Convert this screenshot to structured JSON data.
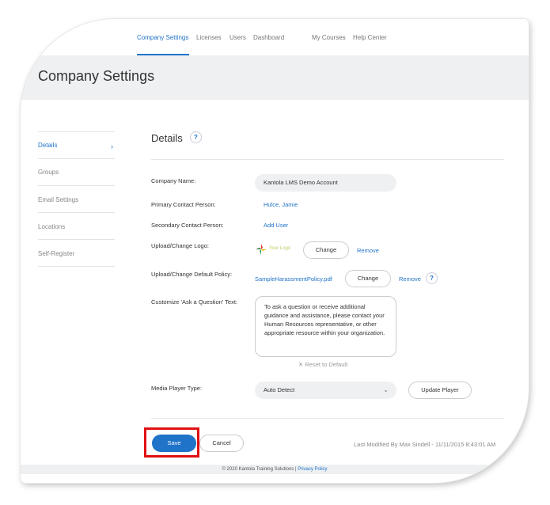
{
  "nav": {
    "items": [
      {
        "label": "Company Settings",
        "active": true
      },
      {
        "label": "Licenses",
        "active": false
      },
      {
        "label": "Users",
        "active": false
      },
      {
        "label": "Dashboard",
        "active": false
      },
      {
        "label": "My Courses",
        "active": false
      },
      {
        "label": "Help Center",
        "active": false
      }
    ]
  },
  "page_title": "Company Settings",
  "sidebar": {
    "items": [
      {
        "label": "Details",
        "active": true
      },
      {
        "label": "Groups",
        "active": false
      },
      {
        "label": "Email Settings",
        "active": false
      },
      {
        "label": "Locations",
        "active": false
      },
      {
        "label": "Self-Register",
        "active": false
      }
    ]
  },
  "details": {
    "title": "Details",
    "help_glyph": "?",
    "company_name_label": "Company Name:",
    "company_name_value": "Kantola LMS Demo Account",
    "primary_contact_label": "Primary Contact Person:",
    "primary_contact_value": "Hulce, Jamie",
    "secondary_contact_label": "Secondary Contact Person:",
    "secondary_contact_link": "Add User",
    "logo_label": "Upload/Change Logo:",
    "logo_text": "Your Logo",
    "logo_change": "Change",
    "logo_remove": "Remove",
    "policy_label": "Upload/Change Default Policy:",
    "policy_file": "SampleHarassmentPolicy.pdf",
    "policy_change": "Change",
    "policy_remove": "Remove",
    "ask_label": "Customize 'Ask a Question' Text:",
    "ask_text": "To ask a question or receive additional guidance and assistance, please contact your Human Resources representative, or other appropriate resource within your organization.",
    "reset_label": "Reset to Default",
    "media_label": "Media Player Type:",
    "media_value": "Auto Detect",
    "update_player": "Update Player"
  },
  "actions": {
    "save": "Save",
    "cancel": "Cancel",
    "last_modified": "Last Modified By Max Sindell - 11/11/2015 8:43:01 AM"
  },
  "footer": {
    "copyright": "© 2020 Kantola Training Solutions |",
    "privacy": "Privacy Policy"
  },
  "colors": {
    "accent": "#1f73c8",
    "highlight": "#e01010"
  }
}
